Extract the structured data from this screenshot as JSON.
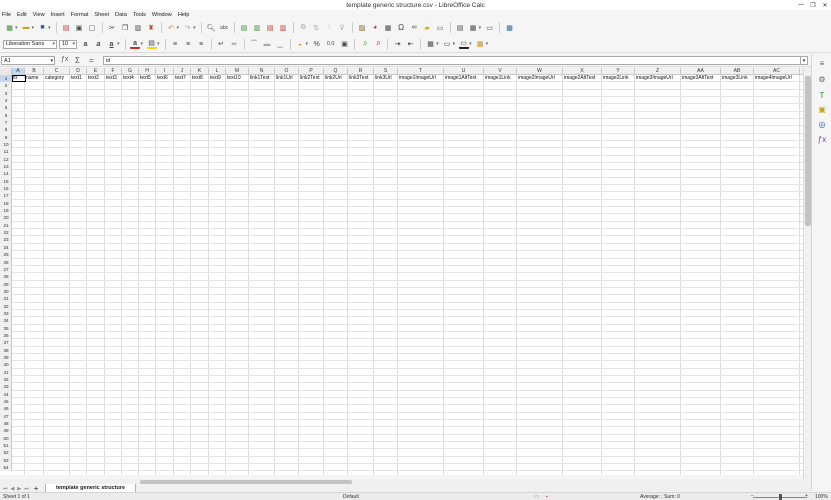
{
  "window": {
    "title": "template generic structure.csv - LibreOffice Calc",
    "controls": [
      "—",
      "❐",
      "✕"
    ]
  },
  "menu": [
    "File",
    "Edit",
    "View",
    "Insert",
    "Format",
    "Sheet",
    "Data",
    "Tools",
    "Window",
    "Help"
  ],
  "format_toolbar": {
    "font_name": "Liberation Sans",
    "font_size": "10",
    "percent_label": "%",
    "decimal_label": "0.0"
  },
  "formula_bar": {
    "name_box": "A1",
    "content": "id"
  },
  "columns": [
    "A",
    "B",
    "C",
    "D",
    "E",
    "F",
    "G",
    "H",
    "I",
    "J",
    "K",
    "L",
    "M",
    "N",
    "O",
    "P",
    "Q",
    "R",
    "S",
    "T",
    "U",
    "V",
    "W",
    "X",
    "Y",
    "Z",
    "AA",
    "AB",
    "AC"
  ],
  "rows": [
    "1",
    "2",
    "3",
    "4",
    "5",
    "6",
    "7",
    "8",
    "9",
    "10",
    "11",
    "12",
    "13",
    "14",
    "15",
    "16",
    "17",
    "18",
    "19",
    "20",
    "21",
    "22",
    "23",
    "24",
    "25",
    "26",
    "27",
    "28",
    "29",
    "30",
    "31",
    "32",
    "33",
    "34",
    "35",
    "36",
    "37",
    "38",
    "39",
    "40",
    "41",
    "42",
    "43",
    "44",
    "45",
    "46",
    "47",
    "48",
    "49",
    "50",
    "51",
    "52",
    "53",
    "54"
  ],
  "row1": [
    "id",
    "name",
    "category",
    "text1",
    "text2",
    "text3",
    "text4",
    "text5",
    "text6",
    "text7",
    "text8",
    "text9",
    "text10",
    "link1Text",
    "link1Url",
    "link2Text",
    "link2Url",
    "link3Text",
    "link3Url",
    "image1ImageUrl",
    "image1AltText",
    "image1Link",
    "image2ImageUrl",
    "image2AltText",
    "image2Link",
    "image3ImageUrl",
    "image3AltText",
    "image3Link",
    "image4ImageUrl"
  ],
  "sheet_tab": "template generic structure",
  "status": {
    "sheet": "Sheet 1 of 1",
    "page_style": "Default",
    "summary": "Average: ; Sum: 0",
    "zoom": "100%"
  }
}
